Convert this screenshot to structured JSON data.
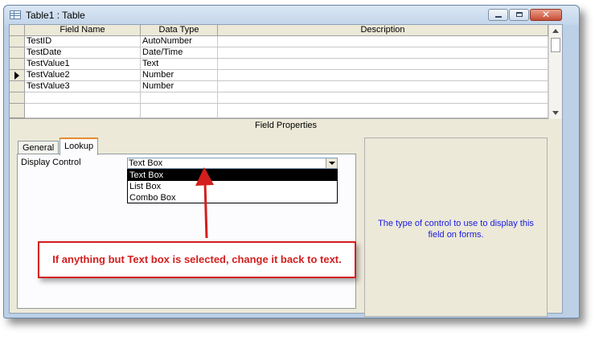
{
  "window": {
    "title": "Table1 : Table",
    "controls": {
      "close_glyph": "✕"
    }
  },
  "grid": {
    "columns": [
      "Field Name",
      "Data Type",
      "Description"
    ],
    "rows": [
      {
        "field": "TestID",
        "type": "AutoNumber",
        "desc": ""
      },
      {
        "field": "TestDate",
        "type": "Date/Time",
        "desc": ""
      },
      {
        "field": "TestValue1",
        "type": "Text",
        "desc": ""
      },
      {
        "field": "TestValue2",
        "type": "Number",
        "desc": "",
        "current": true
      },
      {
        "field": "TestValue3",
        "type": "Number",
        "desc": ""
      }
    ]
  },
  "field_properties": {
    "title": "Field Properties",
    "tabs": [
      "General",
      "Lookup"
    ],
    "active_tab": "Lookup",
    "display_control": {
      "label": "Display Control",
      "value": "Text Box",
      "options": [
        "Text Box",
        "List Box",
        "Combo Box"
      ],
      "highlighted": "Text Box"
    },
    "help_text": "The type of control to use to display this field on forms."
  },
  "annotation": {
    "text": "If anything but Text box is selected, change it back to text.",
    "color": "#d41e1e"
  }
}
